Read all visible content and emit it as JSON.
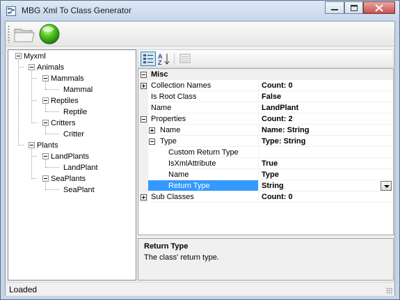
{
  "window": {
    "title": "MBG Xml To Class Generator",
    "controls": [
      "minimize-icon",
      "restore-icon",
      "close-icon"
    ]
  },
  "toolbar": {
    "buttons": [
      {
        "name": "open-folder-button",
        "icon": "folder-icon"
      },
      {
        "name": "generate-button",
        "icon": "green-orb-icon"
      }
    ]
  },
  "tree": {
    "root": "Myxml",
    "animals": "Animals",
    "mammals": "Mammals",
    "mammal": "Mammal",
    "reptiles": "Reptiles",
    "reptile": "Reptile",
    "critters": "Critters",
    "critter": "Critter",
    "plants": "Plants",
    "landplants": "LandPlants",
    "landplant": "LandPlant",
    "seaplants": "SeaPlants",
    "seaplant": "SeaPlant"
  },
  "property_toolbar": {
    "buttons": [
      "categorized-icon",
      "alphabetical-icon",
      "property-pages-icon"
    ]
  },
  "properties": {
    "category": "Misc",
    "collection_names": {
      "name": "Collection Names",
      "value": "Count: 0"
    },
    "is_root_class": {
      "name": "Is Root Class",
      "value": "False"
    },
    "name": {
      "name": "Name",
      "value": "LandPlant"
    },
    "props": {
      "name": "Properties",
      "value": "Count: 2"
    },
    "p_name": {
      "name": "Name",
      "value": "Name: String"
    },
    "p_type": {
      "name": "Type",
      "value": "Type: String"
    },
    "custom_return_type": {
      "name": "Custom Return Type",
      "value": ""
    },
    "is_xml_attribute": {
      "name": "IsXmlAttribute",
      "value": "True"
    },
    "t_name": {
      "name": "Name",
      "value": "Type"
    },
    "return_type": {
      "name": "Return Type",
      "value": "String"
    },
    "sub_classes": {
      "name": "Sub Classes",
      "value": "Count: 0"
    }
  },
  "help": {
    "title": "Return Type",
    "description": "The class' return type."
  },
  "status": {
    "text": "Loaded"
  },
  "colors": {
    "selection": "#3399ff",
    "window_frame": "#c6d5e6",
    "close_button": "#c75050"
  }
}
